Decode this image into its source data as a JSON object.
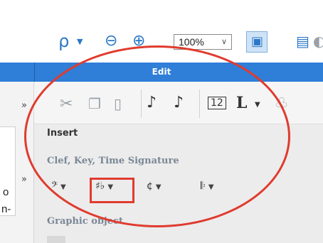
{
  "toolbar": {
    "zoom_value": "100%",
    "icons": [
      "voice-icon",
      "zoom-out-icon",
      "zoom-in-icon",
      "page-view-icon",
      "palette-icon"
    ]
  },
  "edit_panel": {
    "title": "Edit"
  },
  "insert_panel": {
    "title": "Insert",
    "clef_group": {
      "title": "Clef, Key, Time Signature",
      "items": [
        {
          "name": "clef-dropdown",
          "icon": "𝄢"
        },
        {
          "name": "key-signature-dropdown",
          "icon": "♯♭"
        },
        {
          "name": "time-signature-dropdown",
          "icon": "¢"
        },
        {
          "name": "barline-dropdown",
          "icon": "𝄆"
        }
      ]
    },
    "graphic_group": {
      "title": "Graphic object"
    }
  },
  "colors": {
    "accent": "#2f7ed8",
    "highlight": "#e03b2e",
    "icon_blue": "#2b78c6"
  }
}
